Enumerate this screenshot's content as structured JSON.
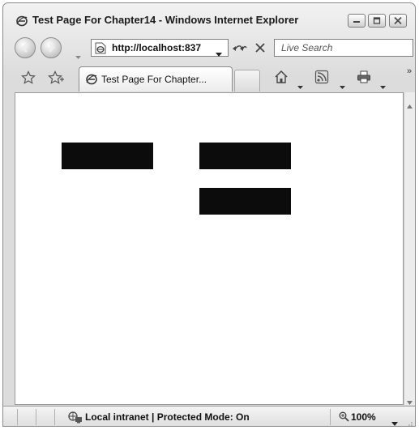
{
  "window": {
    "title": "Test Page For Chapter14 - Windows Internet Explorer"
  },
  "address_bar": {
    "url": "http://localhost:837"
  },
  "search": {
    "placeholder": "Live Search"
  },
  "tabs": [
    {
      "label": "Test Page For Chapter..."
    }
  ],
  "content": {
    "blocks": [
      {
        "name": "black-block-left",
        "color": "#0c0c0c"
      },
      {
        "name": "black-block-right-top",
        "color": "#0c0c0c"
      },
      {
        "name": "black-block-right-bottom",
        "color": "#0c0c0c"
      }
    ]
  },
  "status_bar": {
    "zone_text": "Local intranet | Protected Mode: On",
    "zoom": "100%"
  },
  "icons": {
    "app": "ie-logo-icon",
    "back": "back-arrow-icon",
    "forward": "forward-arrow-icon",
    "refresh": "refresh-icon",
    "stop": "stop-icon",
    "favorites": "star-icon",
    "add_favorites": "add-favorite-icon",
    "home": "home-icon",
    "feeds": "rss-feed-icon",
    "print": "printer-icon",
    "zone": "network-zone-icon",
    "zoom": "magnifier-icon"
  }
}
